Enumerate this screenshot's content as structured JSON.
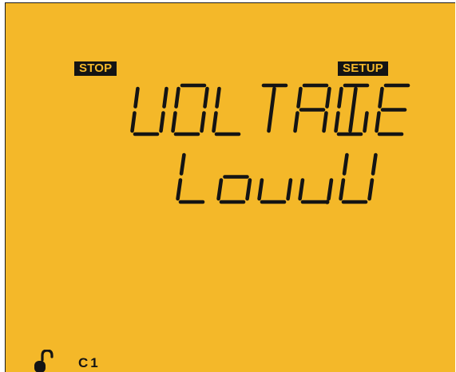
{
  "display": {
    "status_tag": "STOP",
    "mode_tag": "SETUP",
    "line1": "UOLTAGE",
    "line2": "Louu.U",
    "channel": "C1"
  },
  "icons": {
    "lock": "open-padlock-icon"
  },
  "colors": {
    "lcd_background": "#f4b829",
    "segment_ink": "#141414"
  }
}
